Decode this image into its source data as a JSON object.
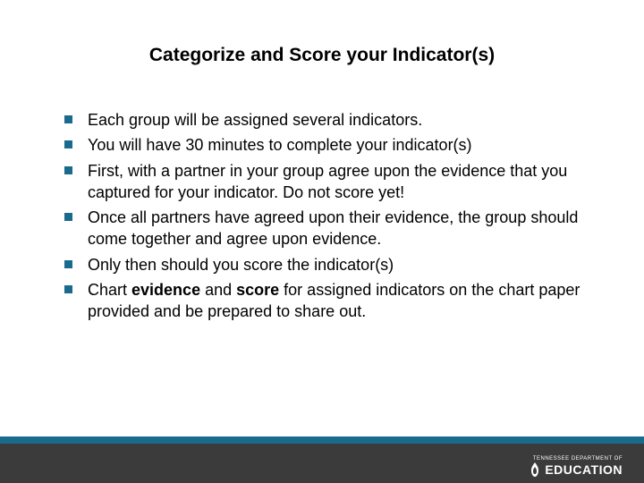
{
  "title": "Categorize and Score your Indicator(s)",
  "bullets": {
    "0": "Each group will be assigned several indicators.",
    "1": "You will have 30 minutes to complete your indicator(s)",
    "2": "First, with a partner in your group agree upon the evidence that you captured for your indicator. Do not score yet!",
    "3": "Once all partners have agreed upon their evidence, the group should come together and agree upon evidence.",
    "4": "Only then should you score the indicator(s)",
    "5a": "Chart ",
    "5b": "evidence",
    "5c": " and ",
    "5d": "score",
    "5e": " for assigned indicators on the chart paper provided and be prepared to share out."
  },
  "logo": {
    "topline": "TENNESSEE DEPARTMENT OF",
    "main": "EDUCATION"
  }
}
